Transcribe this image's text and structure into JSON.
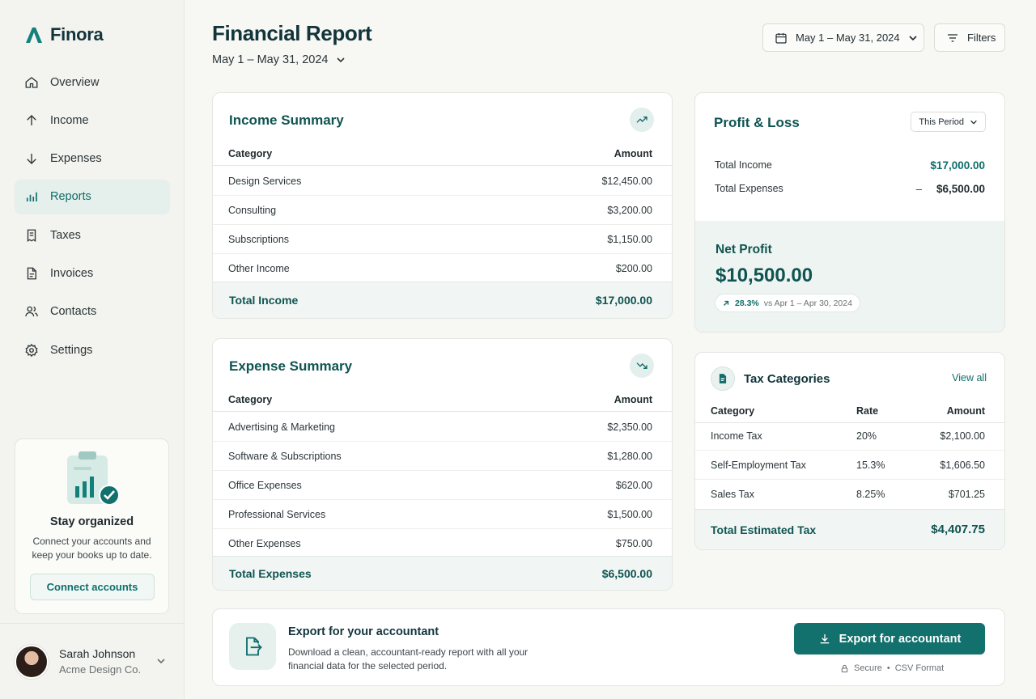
{
  "brand": {
    "name": "Finora"
  },
  "sidebar": {
    "items": [
      {
        "label": "Overview",
        "icon": "home-icon"
      },
      {
        "label": "Income",
        "icon": "arrow-up-icon"
      },
      {
        "label": "Expenses",
        "icon": "arrow-down-icon"
      },
      {
        "label": "Reports",
        "icon": "bar-chart-icon",
        "active": true
      },
      {
        "label": "Taxes",
        "icon": "receipt-icon"
      },
      {
        "label": "Invoices",
        "icon": "document-icon"
      },
      {
        "label": "Contacts",
        "icon": "users-icon"
      },
      {
        "label": "Settings",
        "icon": "gear-icon"
      }
    ],
    "promo": {
      "title": "Stay organized",
      "text": "Connect your accounts and keep your books up to date.",
      "button": "Connect accounts"
    },
    "user": {
      "name": "Sarah Johnson",
      "company": "Acme Design Co."
    }
  },
  "header": {
    "title": "Financial Report",
    "period": "May 1 – May 31, 2024",
    "date_button": "May 1 – May 31, 2024",
    "filters_button": "Filters"
  },
  "income": {
    "title": "Income Summary",
    "columns": [
      "Category",
      "Amount"
    ],
    "rows": [
      {
        "category": "Design Services",
        "amount": "$12,450.00"
      },
      {
        "category": "Consulting",
        "amount": "$3,200.00"
      },
      {
        "category": "Subscriptions",
        "amount": "$1,150.00"
      },
      {
        "category": "Other Income",
        "amount": "$200.00"
      }
    ],
    "total_label": "Total Income",
    "total_value": "$17,000.00"
  },
  "expense": {
    "title": "Expense Summary",
    "columns": [
      "Category",
      "Amount"
    ],
    "rows": [
      {
        "category": "Advertising & Marketing",
        "amount": "$2,350.00"
      },
      {
        "category": "Software & Subscriptions",
        "amount": "$1,280.00"
      },
      {
        "category": "Office Expenses",
        "amount": "$620.00"
      },
      {
        "category": "Professional Services",
        "amount": "$1,500.00"
      },
      {
        "category": "Other Expenses",
        "amount": "$750.00"
      }
    ],
    "total_label": "Total Expenses",
    "total_value": "$6,500.00"
  },
  "pnl": {
    "title": "Profit & Loss",
    "select": "This Period",
    "income_label": "Total Income",
    "income_value": "$17,000.00",
    "expense_label": "Total Expenses",
    "expense_sign": "–",
    "expense_value": "$6,500.00",
    "net_label": "Net Profit",
    "net_value": "$10,500.00",
    "change_pct": "28.3%",
    "change_text": "vs Apr 1 – Apr 30, 2024"
  },
  "tax": {
    "title": "Tax Categories",
    "view_all": "View all",
    "columns": [
      "Category",
      "Rate",
      "Amount"
    ],
    "rows": [
      {
        "category": "Income Tax",
        "rate": "20%",
        "amount": "$2,100.00"
      },
      {
        "category": "Self-Employment Tax",
        "rate": "15.3%",
        "amount": "$1,606.50"
      },
      {
        "category": "Sales Tax",
        "rate": "8.25%",
        "amount": "$701.25"
      }
    ],
    "total_label": "Total Estimated Tax",
    "total_value": "$4,407.75"
  },
  "export": {
    "title": "Export for your accountant",
    "description": "Download a clean, accountant-ready report with all your financial data for the selected period.",
    "button": "Export for accountant",
    "secure": "Secure",
    "format": "CSV Format"
  },
  "colors": {
    "accent": "#13716d",
    "heading": "#0f5451",
    "active_bg": "#e5efec"
  }
}
